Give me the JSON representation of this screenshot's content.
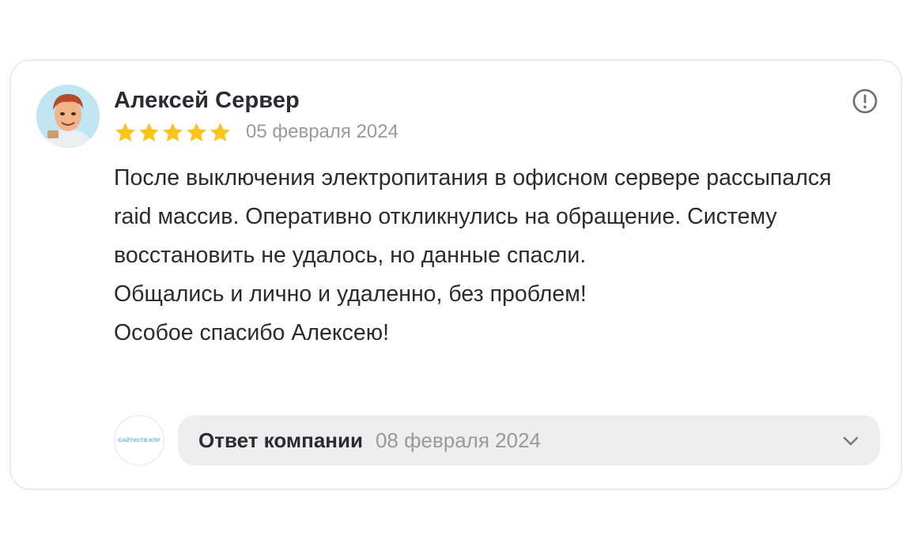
{
  "review": {
    "author": "Алексей Сервер",
    "rating": 5,
    "rating_max": 5,
    "date": "05 февраля 2024",
    "paragraphs": [
      "После выключения электропитания в офисном сервере рассыпался raid массив. Оперативно откликнулись на обращение. Систему восстановить не удалось, но данные спасли.",
      "Общались и лично и удаленно, без проблем!",
      "Особое спасибо Алексею!"
    ],
    "report_icon": "exclamation-circle-icon"
  },
  "company_reply": {
    "logo_text": "САЙТИСТВ.КПР",
    "label": "Ответ компании",
    "date": "08 февраля 2024",
    "toggle_icon": "chevron-down-icon"
  },
  "colors": {
    "star": "#fcc419",
    "accent_text": "#2b2b33",
    "muted": "#9a9a9a",
    "reply_bg": "#eeeeee"
  }
}
